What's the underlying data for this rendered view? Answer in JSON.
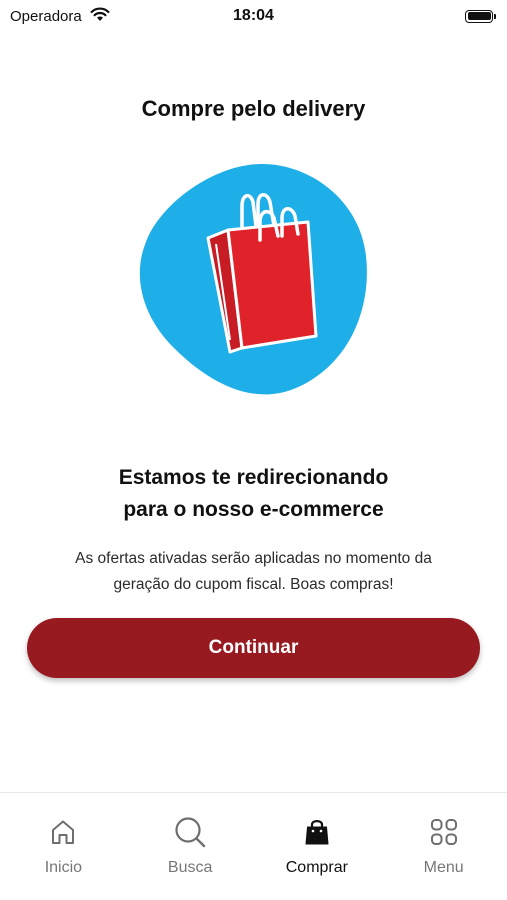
{
  "status_bar": {
    "carrier": "Operadora",
    "time": "18:04"
  },
  "page": {
    "title": "Compre pelo delivery",
    "headline_line1": "Estamos te redirecionando",
    "headline_line2": "para o nosso e-commerce",
    "message_line1": "As ofertas ativadas serão aplicadas no momento da",
    "message_line2": "geração do cupom fiscal. Boas compras!",
    "continue_label": "Continuar"
  },
  "illustration": {
    "icon": "shopping-bag-icon",
    "blob_color": "#1eaee8",
    "bag_color": "#e0222a"
  },
  "tabs": [
    {
      "label": "Inicio",
      "icon": "home-icon",
      "active": false
    },
    {
      "label": "Busca",
      "icon": "search-icon",
      "active": false
    },
    {
      "label": "Comprar",
      "icon": "shopping-bag-icon",
      "active": true
    },
    {
      "label": "Menu",
      "icon": "grid-icon",
      "active": false
    }
  ],
  "colors": {
    "primary": "#971a20",
    "text": "#111111",
    "muted": "#777777"
  }
}
